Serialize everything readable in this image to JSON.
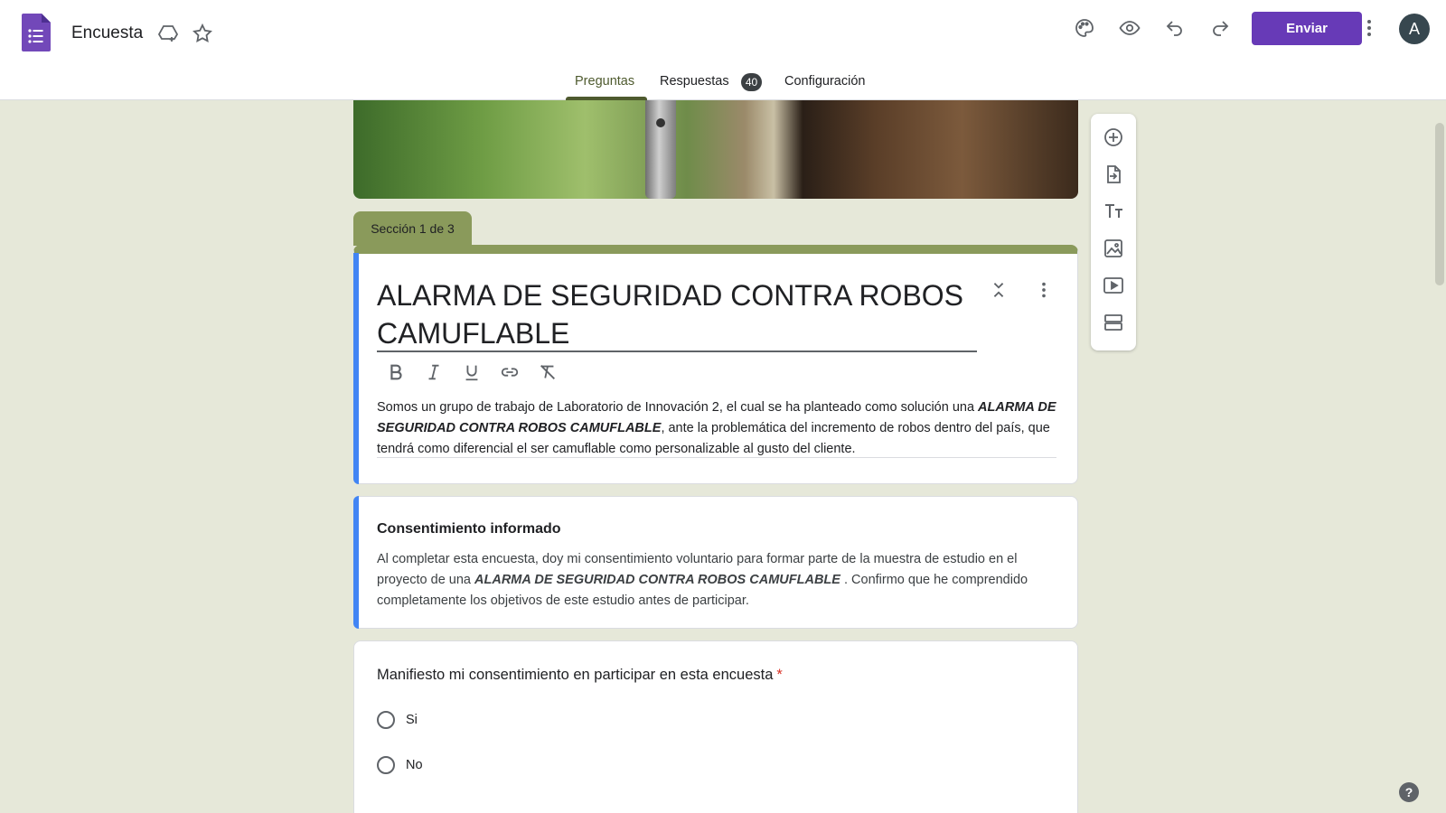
{
  "app": {
    "title": "Encuesta",
    "send_label": "Enviar",
    "avatar_initial": "A",
    "accent_color": "#673ab7"
  },
  "tabs": [
    {
      "label": "Preguntas",
      "active": true
    },
    {
      "label": "Respuestas",
      "badge": "40"
    },
    {
      "label": "Configuración"
    }
  ],
  "section": {
    "label": "Sección 1 de 3"
  },
  "form": {
    "title": "ALARMA DE SEGURIDAD CONTRA ROBOS CAMUFLABLE",
    "description_pre": "Somos un grupo de trabajo de Laboratorio de Innovación 2, el cual se ha planteado como solución una ",
    "description_bold": "ALARMA DE SEGURIDAD CONTRA ROBOS CAMUFLABLE",
    "description_post": ", ante la problemática del incremento de robos dentro del país, que tendrá como diferencial el ser camuflable como personalizable al gusto del cliente."
  },
  "consent": {
    "title": "Consentimiento informado",
    "text_pre": "Al completar esta encuesta, doy mi consentimiento voluntario para formar parte de la muestra de estudio en el proyecto de una ",
    "text_bold": "ALARMA DE SEGURIDAD CONTRA ROBOS CAMUFLABLE",
    "text_post": " .  Confirmo que he comprendido completamente los objetivos de este estudio antes de participar."
  },
  "question": {
    "text": "Manifiesto mi consentimiento en participar en esta encuesta",
    "required_mark": "*",
    "options": [
      "Si",
      "No"
    ]
  },
  "help_label": "?"
}
